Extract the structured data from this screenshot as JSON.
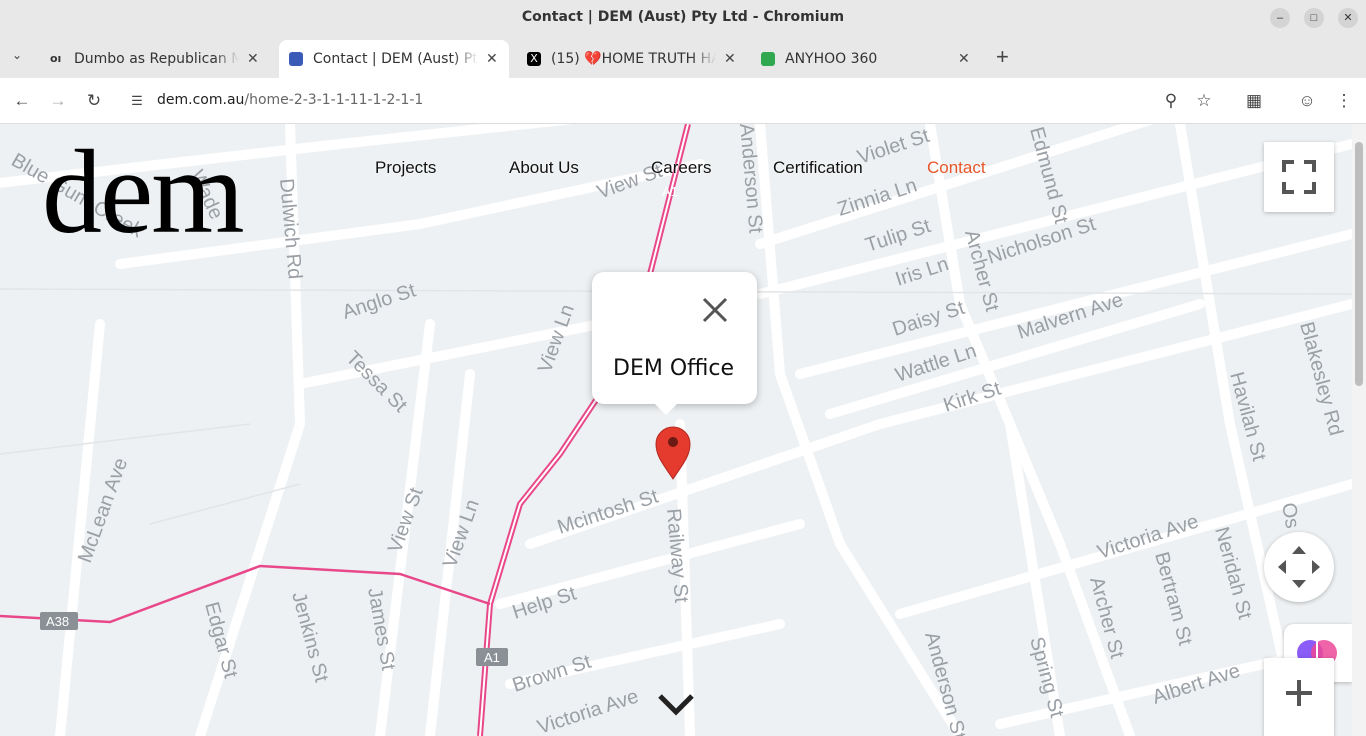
{
  "window": {
    "title": "Contact | DEM (Aust) Pty Ltd - Chromium"
  },
  "tabs": [
    {
      "label": "Dumbo as Republican Ma",
      "active": false
    },
    {
      "label": "Contact | DEM (Aust) Pty",
      "active": true
    },
    {
      "label": "(15) 💔HOME TRUTH HAI",
      "active": false
    },
    {
      "label": "ANYHOO 360",
      "active": false
    }
  ],
  "toolbar": {
    "url_domain": "dem.com.au",
    "url_path": "/home-2-3-1-1-11-1-2-1-1"
  },
  "site": {
    "logo": "dem",
    "nav": [
      {
        "label": "Projects"
      },
      {
        "label": "About Us"
      },
      {
        "label": "Careers"
      },
      {
        "label": "Certification"
      },
      {
        "label": "Contact"
      }
    ],
    "accent_color": "#e8572a"
  },
  "map": {
    "marker_title": "DEM Office",
    "streets": [
      "Blue Gum Creek",
      "Wade",
      "Dulwich Rd",
      "View St",
      "A1",
      "Anderson St",
      "Violet St",
      "Zinnia Ln",
      "Tulip St",
      "Iris Ln",
      "Nicholson St",
      "Archer St",
      "Edmund St",
      "Anglo St",
      "Tessa St",
      "View Ln",
      "Daisy St",
      "Malvern Ave",
      "Wattle Ln",
      "Kirk St",
      "Havilah St",
      "Blakesley Rd",
      "McLean Ave",
      "View St",
      "View Ln",
      "Mcintosh St",
      "Railway St",
      "Victoria Ave",
      "Bertram St",
      "Neridah St",
      "Edgar St",
      "Jenkins St",
      "James St",
      "Help St",
      "A38",
      "A1",
      "Brown St",
      "Anderson St",
      "Spring St",
      "Archer St",
      "Albert Ave",
      "Victoria Ave",
      "Os"
    ]
  }
}
